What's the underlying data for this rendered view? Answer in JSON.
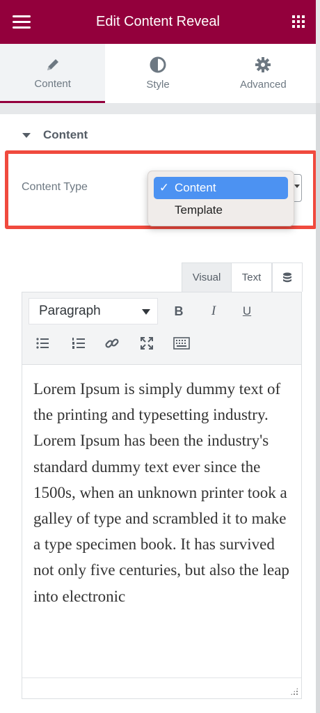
{
  "header": {
    "title": "Edit Content Reveal",
    "background": "#93003c"
  },
  "tabs": [
    {
      "label": "Content",
      "icon": "pencil-icon",
      "active": true
    },
    {
      "label": "Style",
      "icon": "half-circle-icon",
      "active": false
    },
    {
      "label": "Advanced",
      "icon": "gear-icon",
      "active": false
    }
  ],
  "section": {
    "title": "Content"
  },
  "content_type": {
    "label": "Content Type",
    "options": [
      {
        "label": "Content",
        "selected": true
      },
      {
        "label": "Template",
        "selected": false
      }
    ]
  },
  "editor": {
    "tabs": {
      "visual": "Visual",
      "text": "Text"
    },
    "format": "Paragraph",
    "buttons": {
      "bold": "B",
      "italic": "I",
      "underline": "U"
    },
    "body": "Lorem Ipsum is simply dummy text of the printing and typesetting industry. Lorem Ipsum has been the industry's standard dummy text ever since the 1500s, when an unknown printer took a galley of type and scrambled it to make a type specimen book. It has survived not only five centuries, but also the leap into electronic"
  },
  "colors": {
    "accent": "#93003c",
    "highlight": "#f04a3e",
    "selected": "#4c92f2"
  }
}
